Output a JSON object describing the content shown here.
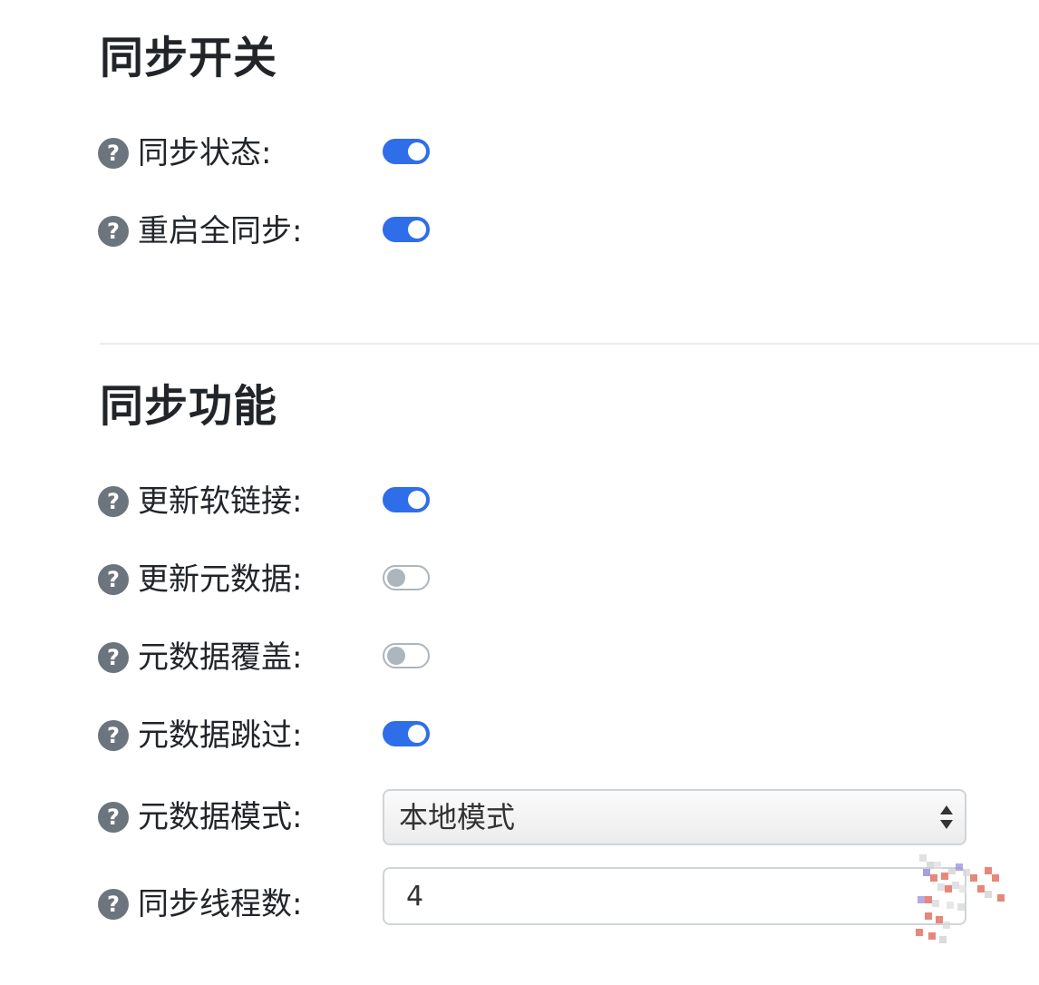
{
  "sections": [
    {
      "title": "同步开关",
      "rows": [
        {
          "label": "同步状态:",
          "type": "toggle",
          "on": true
        },
        {
          "label": "重启全同步:",
          "type": "toggle",
          "on": true
        }
      ]
    },
    {
      "title": "同步功能",
      "rows": [
        {
          "label": "更新软链接:",
          "type": "toggle",
          "on": true
        },
        {
          "label": "更新元数据:",
          "type": "toggle",
          "on": false
        },
        {
          "label": "元数据覆盖:",
          "type": "toggle",
          "on": false
        },
        {
          "label": "元数据跳过:",
          "type": "toggle",
          "on": true
        },
        {
          "label": "元数据模式:",
          "type": "select",
          "value": "本地模式"
        },
        {
          "label": "同步线程数:",
          "type": "number",
          "value": "4"
        }
      ]
    }
  ],
  "help_icon_glyph": "?",
  "colors": {
    "toggle_on": "#2f6ee9",
    "toggle_off": "#adb5bd",
    "help_icon": "#6c757d"
  }
}
